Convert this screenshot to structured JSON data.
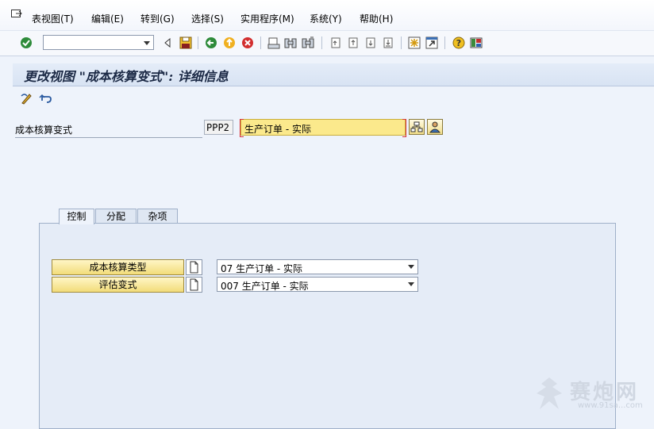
{
  "menu": {
    "items": [
      "表视图(T)",
      "编辑(E)",
      "转到(G)",
      "选择(S)",
      "实用程序(M)",
      "系统(Y)",
      "帮助(H)"
    ]
  },
  "toolbar": {
    "command_value": "",
    "icons": [
      "enter-icon",
      "back-arrow-icon",
      "save-icon",
      "back-icon",
      "exit-icon",
      "cancel-icon",
      "print-icon",
      "find-icon",
      "find-next-icon",
      "first-page-icon",
      "previous-page-icon",
      "next-page-icon",
      "last-page-icon",
      "new-session-icon",
      "shortcut-icon",
      "help-icon",
      "layout-icon"
    ]
  },
  "page": {
    "title": "更改视图 \"成本核算变式\": 详细信息"
  },
  "key": {
    "label": "成本核算变式",
    "code": "PPP2",
    "description": "生产订单 - 实际"
  },
  "tabs": [
    "控制",
    "分配",
    "杂项"
  ],
  "active_tab": "控制",
  "fields": [
    {
      "button_label": "成本核算类型",
      "value": "07 生产订单 - 实际"
    },
    {
      "button_label": "评估变式",
      "value": "007 生产订单 - 实际"
    }
  ],
  "watermark": {
    "text": "赛炮网",
    "url": "www.91sa...com"
  },
  "colors": {
    "background": "#eef3fb",
    "required_field": "#fbe98c",
    "button": "#f2dc7a",
    "title_text": "#1c2a46"
  }
}
